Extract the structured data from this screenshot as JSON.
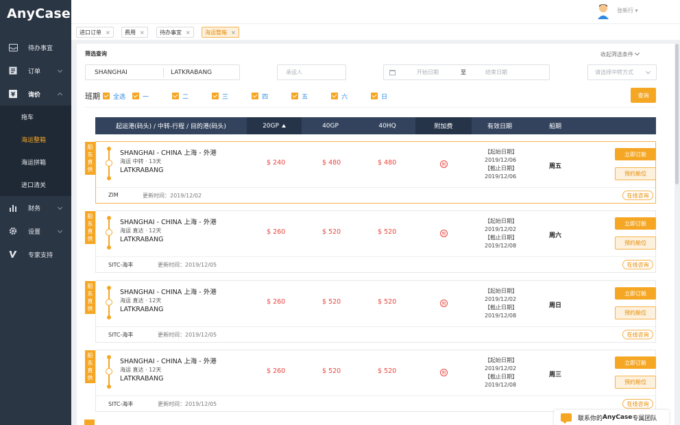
{
  "app": {
    "logo": "AnyCase"
  },
  "sidebar": {
    "items": [
      {
        "label": "待办事宜",
        "icon": "inbox-icon"
      },
      {
        "label": "订单",
        "icon": "order-icon"
      },
      {
        "label": "询价",
        "icon": "yen-icon"
      },
      {
        "label": "财务",
        "icon": "finance-chart-icon"
      },
      {
        "label": "设置",
        "icon": "gear-icon"
      },
      {
        "label": "专家支持",
        "icon": "expert-v-icon"
      }
    ],
    "submenu": [
      "拖车",
      "海运整箱",
      "海运拼箱",
      "进口清关"
    ]
  },
  "header": {
    "username": "张新行"
  },
  "tabs": [
    "进口订单",
    "费用",
    "待办事宜",
    "海运整箱"
  ],
  "filter": {
    "title": "筛选查询",
    "collapse": "收起筛选条件",
    "pol": "SHANGHAI",
    "pod": "LATKRABANG",
    "carrier_placeholder": "承运人",
    "start_placeholder": "开始日期",
    "to": "至",
    "end_placeholder": "结束日期",
    "transfer_placeholder": "请选择中转方式",
    "week_label": "班期",
    "days": [
      "全选",
      "一",
      "二",
      "三",
      "四",
      "五",
      "六",
      "日"
    ],
    "query_button": "查询"
  },
  "table": {
    "headers": [
      "起运港(码头) / 中转-行程 / 目的港(码头)",
      "20GP",
      "40GP",
      "40HQ",
      "附加费",
      "有效日期",
      "船期"
    ]
  },
  "accent_color": "#f5a623",
  "cards": [
    {
      "ribbon": [
        "船",
        "东",
        "直",
        "供"
      ],
      "pol": "SHANGHAI - CHINA 上海 - 外港",
      "via": "海运  中转 · 13天",
      "pod": "LATKRABANG",
      "p20": "$ 240",
      "p40": "$ 480",
      "p40hq": "$ 480",
      "surcharge": "附",
      "valid": [
        "【起始日期】",
        "2019/12/06",
        "【截止日期】",
        "2019/12/06"
      ],
      "sailing": "周五",
      "book": "立即订舱",
      "reserve": "预约舱位",
      "carrier": "ZIM",
      "updated": "更新时间：2019/12/02",
      "consult": "在线咨询"
    },
    {
      "ribbon": [
        "船",
        "东",
        "直",
        "供"
      ],
      "pol": "SHANGHAI - CHINA 上海 - 外港",
      "via": "海运  直达 · 12天",
      "pod": "LATKRABANG",
      "p20": "$ 260",
      "p40": "$ 520",
      "p40hq": "$ 520",
      "surcharge": "附",
      "valid": [
        "【起始日期】",
        "2019/12/02",
        "【截止日期】",
        "2019/12/08"
      ],
      "sailing": "周六",
      "book": "立即订舱",
      "reserve": "预约舱位",
      "carrier": "SITC-海丰",
      "updated": "更新时间：2019/12/05",
      "consult": "在线咨询"
    },
    {
      "ribbon": [
        "船",
        "东",
        "直",
        "供"
      ],
      "pol": "SHANGHAI - CHINA 上海 - 外港",
      "via": "海运  直达 · 12天",
      "pod": "LATKRABANG",
      "p20": "$ 260",
      "p40": "$ 520",
      "p40hq": "$ 520",
      "surcharge": "附",
      "valid": [
        "【起始日期】",
        "2019/12/02",
        "【截止日期】",
        "2019/12/08"
      ],
      "sailing": "周日",
      "book": "立即订舱",
      "reserve": "预约舱位",
      "carrier": "SITC-海丰",
      "updated": "更新时间：2019/12/05",
      "consult": "在线咨询"
    },
    {
      "ribbon": [
        "船",
        "东",
        "直",
        "供"
      ],
      "pol": "SHANGHAI - CHINA 上海 - 外港",
      "via": "海运  直达 · 12天",
      "pod": "LATKRABANG",
      "p20": "$ 260",
      "p40": "$ 520",
      "p40hq": "$ 520",
      "surcharge": "附",
      "valid": [
        "【起始日期】",
        "2019/12/02",
        "【截止日期】",
        "2019/12/08"
      ],
      "sailing": "周三",
      "book": "立即订舱",
      "reserve": "预约舱位",
      "carrier": "SITC-海丰",
      "updated": "更新时间：2019/12/05",
      "consult": "在线咨询"
    }
  ],
  "contact": {
    "text_prefix": "联系你的",
    "brand": "AnyCase",
    "text_suffix": "专属团队"
  }
}
